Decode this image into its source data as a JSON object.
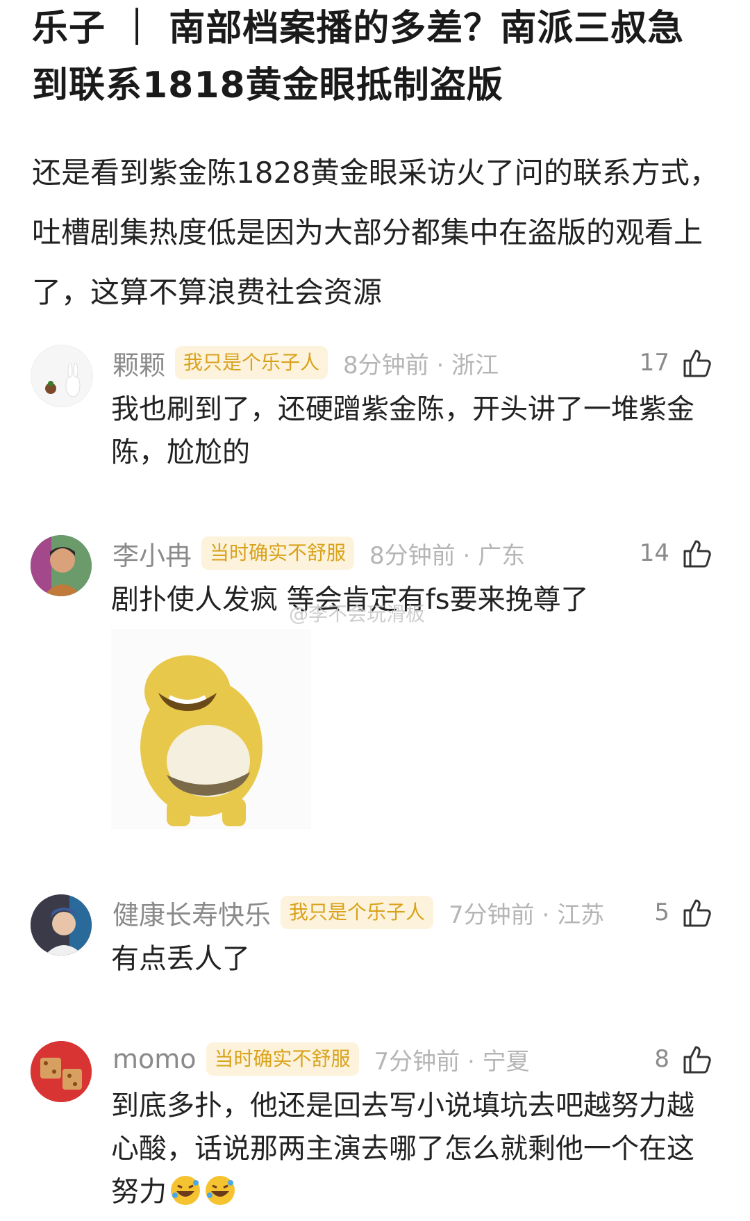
{
  "post": {
    "title": "乐子 ｜ 南部档案播的多差？南派三叔急到联系1818黄金眼抵制盗版",
    "body": "还是看到紫金陈1828黄金眼采访火了问的联系方式，吐槽剧集热度低是因为大部分都集中在盗版的观看上了，这算不算浪费社会资源"
  },
  "watermark": "@李不会玩滑板",
  "comments": [
    {
      "username": "颗颗",
      "badge": "我只是个乐子人",
      "time": "8分钟前 · 浙江",
      "likes": "17",
      "text": "我也刷到了，还硬蹭紫金陈，开头讲了一堆紫金陈，尬尬的",
      "avatar_icon": "rabbit-avatar-icon"
    },
    {
      "username": "李小冉",
      "badge": "当时确实不舒服",
      "time": "8分钟前 · 广东",
      "likes": "14",
      "text": "剧扑使人发疯 等会肯定有fs要来挽尊了",
      "avatar_icon": "person-avatar-icon",
      "sticker_icon": "yellow-bear-laughing-sticker-icon"
    },
    {
      "username": "健康长寿快乐",
      "badge": "我只是个乐子人",
      "time": "7分钟前 · 江苏",
      "likes": "5",
      "text": "有点丢人了",
      "avatar_icon": "person-avatar-icon"
    },
    {
      "username": "momo",
      "badge": "当时确实不舒服",
      "time": "7分钟前 · 宁夏",
      "likes": "8",
      "text": "到底多扑，他还是回去写小说填坑去吧越努力越心酸，话说那两主演去哪了怎么就剩他一个在这努力",
      "emoji_icon": "rolling-laughing-emoji-icon",
      "avatar_icon": "red-food-avatar-icon"
    }
  ],
  "colors": {
    "badge_text": "#d9a21b",
    "badge_bg": "#fdf3dc",
    "meta_gray": "#8a8a8a",
    "time_gray": "#b5b5b5"
  }
}
